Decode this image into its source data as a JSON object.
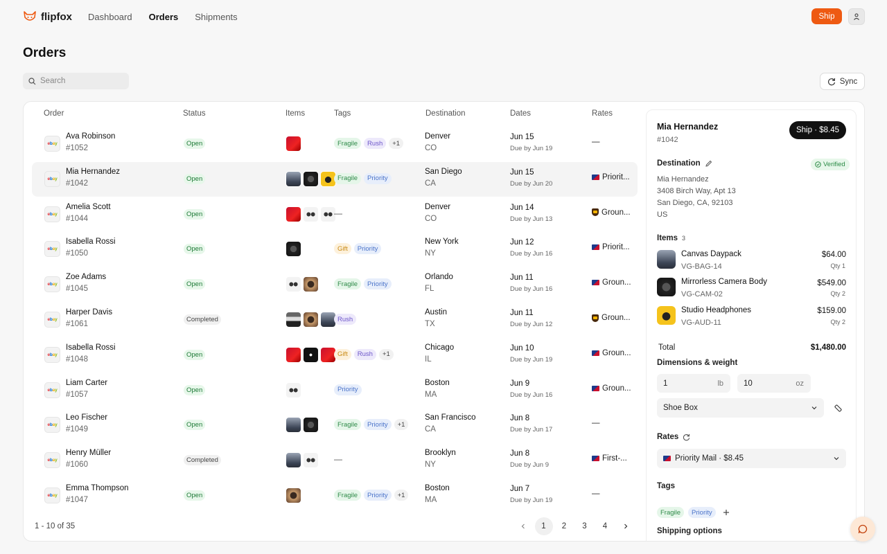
{
  "brand": {
    "name": "flipfox"
  },
  "nav": {
    "items": [
      "Dashboard",
      "Orders",
      "Shipments"
    ],
    "active": "Orders"
  },
  "header": {
    "ship_label": "Ship"
  },
  "page": {
    "title": "Orders"
  },
  "toolbar": {
    "search_placeholder": "Search",
    "sync_label": "Sync"
  },
  "table": {
    "columns": [
      "Order",
      "Status",
      "Items",
      "Tags",
      "Destination",
      "Dates",
      "Rates"
    ],
    "rows": [
      {
        "customer": "Ava Robinson",
        "order": "#1052",
        "status": "Open",
        "items": [
          "shoe-red"
        ],
        "tags": [
          "Fragile",
          "Rush"
        ],
        "more": "+1",
        "city": "Denver",
        "state": "CO",
        "date": "Jun 15",
        "due": "Due by Jun 19",
        "rate": "—",
        "carrier": ""
      },
      {
        "customer": "Mia Hernandez",
        "order": "#1042",
        "status": "Open",
        "items": [
          "bag",
          "camera",
          "headphones"
        ],
        "tags": [
          "Fragile",
          "Priority"
        ],
        "more": "",
        "city": "San Diego",
        "state": "CA",
        "date": "Jun 15",
        "due": "Due by Jun 20",
        "rate": "Priorit...",
        "carrier": "usps"
      },
      {
        "customer": "Amelia Scott",
        "order": "#1044",
        "status": "Open",
        "items": [
          "shoe-red",
          "sunglasses",
          "sunglasses"
        ],
        "tags": [],
        "more": "",
        "city": "Denver",
        "state": "CO",
        "date": "Jun 14",
        "due": "Due by Jun 13",
        "rate": "Groun...",
        "carrier": "ups"
      },
      {
        "customer": "Isabella Rossi",
        "order": "#1050",
        "status": "Open",
        "items": [
          "camera"
        ],
        "tags": [
          "Gift",
          "Priority"
        ],
        "more": "",
        "city": "New York",
        "state": "NY",
        "date": "Jun 12",
        "due": "Due by Jun 16",
        "rate": "Priorit...",
        "carrier": "usps"
      },
      {
        "customer": "Zoe Adams",
        "order": "#1045",
        "status": "Open",
        "items": [
          "sunglasses",
          "bowl"
        ],
        "tags": [
          "Fragile",
          "Priority"
        ],
        "more": "",
        "city": "Orlando",
        "state": "FL",
        "date": "Jun 11",
        "due": "Due by Jun 16",
        "rate": "Groun...",
        "carrier": "usps"
      },
      {
        "customer": "Harper Davis",
        "order": "#1061",
        "status": "Completed",
        "items": [
          "shoe",
          "bowl",
          "bag"
        ],
        "tags": [
          "Rush"
        ],
        "more": "",
        "city": "Austin",
        "state": "TX",
        "date": "Jun 11",
        "due": "Due by Jun 12",
        "rate": "Groun...",
        "carrier": "ups"
      },
      {
        "customer": "Isabella Rossi",
        "order": "#1048",
        "status": "Open",
        "items": [
          "shoe-red",
          "vinyl",
          "shoe-red"
        ],
        "tags": [
          "Gift",
          "Rush"
        ],
        "more": "+1",
        "city": "Chicago",
        "state": "IL",
        "date": "Jun 10",
        "due": "Due by Jun 19",
        "rate": "Groun...",
        "carrier": "usps"
      },
      {
        "customer": "Liam Carter",
        "order": "#1057",
        "status": "Open",
        "items": [
          "sunglasses"
        ],
        "tags": [
          "Priority"
        ],
        "more": "",
        "city": "Boston",
        "state": "MA",
        "date": "Jun 9",
        "due": "Due by Jun 16",
        "rate": "Groun...",
        "carrier": "usps"
      },
      {
        "customer": "Leo Fischer",
        "order": "#1049",
        "status": "Open",
        "items": [
          "bag",
          "camera"
        ],
        "tags": [
          "Fragile",
          "Priority"
        ],
        "more": "+1",
        "city": "San Francisco",
        "state": "CA",
        "date": "Jun 8",
        "due": "Due by Jun 17",
        "rate": "—",
        "carrier": ""
      },
      {
        "customer": "Henry Müller",
        "order": "#1060",
        "status": "Completed",
        "items": [
          "bag",
          "sunglasses"
        ],
        "tags": [],
        "more": "",
        "city": "Brooklyn",
        "state": "NY",
        "date": "Jun 8",
        "due": "Due by Jun 9",
        "rate": "First-...",
        "carrier": "usps"
      },
      {
        "customer": "Emma Thompson",
        "order": "#1047",
        "status": "Open",
        "items": [
          "bowl"
        ],
        "tags": [
          "Fragile",
          "Priority"
        ],
        "more": "+1",
        "city": "Boston",
        "state": "MA",
        "date": "Jun 7",
        "due": "Due by Jun 19",
        "rate": "—",
        "carrier": ""
      }
    ],
    "empty_tags": "—"
  },
  "pagination": {
    "summary": "1 - 10 of 35",
    "pages": [
      "1",
      "2",
      "3",
      "4"
    ],
    "current": "1"
  },
  "panel": {
    "name": "Mia Hernandez",
    "order": "#1042",
    "ship_button": "Ship · $8.45",
    "destination_label": "Destination",
    "verified_label": "Verified",
    "address": [
      "Mia Hernandez",
      "3408 Birch Way, Apt 13",
      "San Diego, CA, 92103",
      "US"
    ],
    "items_label": "Items",
    "items_count": "3",
    "items": [
      {
        "name": "Canvas Daypack",
        "sku": "VG-BAG-14",
        "price": "$64.00",
        "qty": "Qty 1",
        "thumb": "bag"
      },
      {
        "name": "Mirrorless Camera Body",
        "sku": "VG-CAM-02",
        "price": "$549.00",
        "qty": "Qty 2",
        "thumb": "camera"
      },
      {
        "name": "Studio Headphones",
        "sku": "VG-AUD-11",
        "price": "$159.00",
        "qty": "Qty 2",
        "thumb": "headphones"
      }
    ],
    "total_label": "Total",
    "total_value": "$1,480.00",
    "dimensions_label": "Dimensions & weight",
    "weight_lb": "1",
    "weight_lb_unit": "lb",
    "weight_oz": "10",
    "weight_oz_unit": "oz",
    "package": "Shoe Box",
    "rates_label": "Rates",
    "rate_selected": "Priority Mail · $8.45",
    "tags_label": "Tags",
    "tags": [
      "Fragile",
      "Priority"
    ],
    "shipping_options_label": "Shipping options"
  },
  "colors": {
    "accent": "#ee5a12",
    "dark_button": "#111111"
  }
}
